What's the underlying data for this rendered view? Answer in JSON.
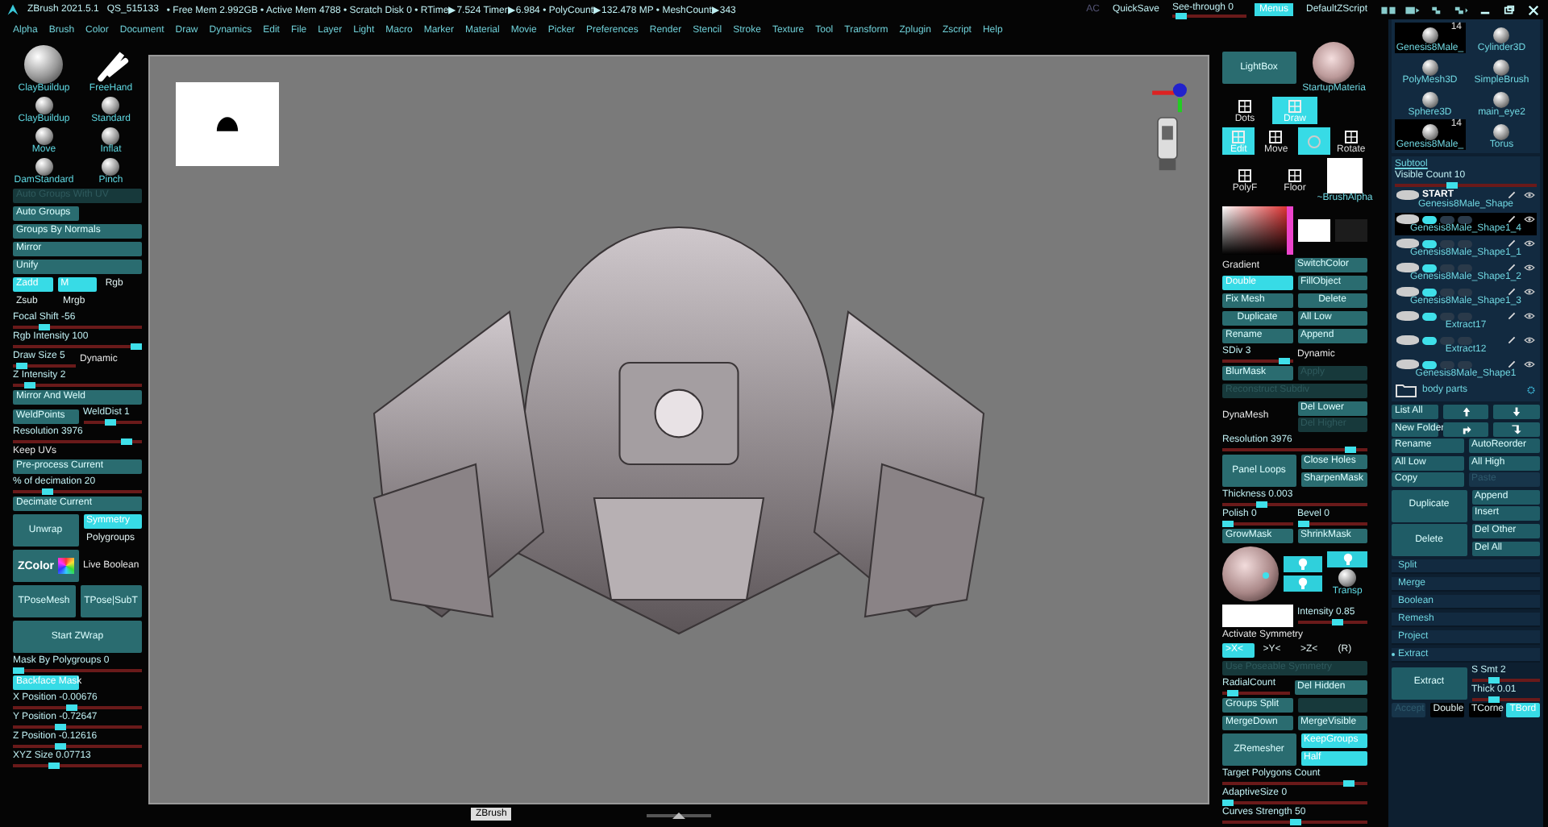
{
  "title_bar": {
    "app": "ZBrush 2021.5.1",
    "project": "QS_515133",
    "stats": "• Free Mem 2.992GB • Active Mem 4788 • Scratch Disk 0 • RTime▶7.524 Timer▶6.984 • PolyCount▶132.478 MP • MeshCount▶343",
    "ac": "AC",
    "quicksave": "QuickSave",
    "see_through": {
      "label": "See-through  0",
      "level": 0.05
    },
    "menus": {
      "label": "Menus",
      "selected": true
    },
    "script": "DefaultZScript"
  },
  "menu_bar": [
    "Alpha",
    "Brush",
    "Color",
    "Document",
    "Draw",
    "Dynamics",
    "Edit",
    "File",
    "Layer",
    "Light",
    "Macro",
    "Marker",
    "Material",
    "Movie",
    "Picker",
    "Preferences",
    "Render",
    "Stencil",
    "Stroke",
    "Texture",
    "Tool",
    "Transform",
    "Zplugin",
    "Zscript",
    "Help"
  ],
  "left_panel": [
    [
      {
        "kind": "brush-large",
        "label": "ClayBuildup"
      },
      {
        "kind": "stroke",
        "label": "FreeHand"
      }
    ],
    [
      {
        "kind": "brush",
        "label": "ClayBuildup"
      },
      {
        "kind": "brush",
        "label": "Standard"
      }
    ],
    [
      {
        "kind": "brush",
        "label": "Move"
      },
      {
        "kind": "brush",
        "label": "Inflat"
      }
    ],
    [
      {
        "kind": "brush",
        "label": "DamStandard"
      },
      {
        "kind": "brush",
        "label": "Pinch"
      }
    ],
    [
      {
        "kind": "disabled",
        "label": "Auto Groups With UV"
      }
    ],
    [
      {
        "kind": "button",
        "label": "Auto Groups"
      },
      {
        "kind": "space"
      }
    ],
    [
      {
        "kind": "button",
        "label": "Groups By Normals"
      }
    ],
    [
      {
        "kind": "button",
        "label": "Mirror"
      }
    ],
    [
      {
        "kind": "button",
        "label": "Unify"
      }
    ],
    [
      {
        "kind": "toggle",
        "label": "Zadd",
        "selected": true
      },
      {
        "kind": "toggle",
        "label": "M",
        "selected": true
      },
      {
        "kind": "toggle",
        "label": "Rgb",
        "selected": false
      }
    ],
    [
      {
        "kind": "toggle",
        "label": "Zsub",
        "selected": false
      },
      {
        "kind": "toggle",
        "label": "Mrgb",
        "selected": false
      },
      {
        "kind": "space"
      }
    ],
    [
      {
        "kind": "slider",
        "label": "Focal Shift -56",
        "level": 0.22
      }
    ],
    [
      {
        "kind": "slider",
        "label": "Rgb Intensity 100",
        "level": 1
      }
    ],
    [
      {
        "kind": "slider",
        "label": "Draw Size 5",
        "level": 0.05
      },
      {
        "kind": "label",
        "text": "Dynamic"
      }
    ],
    [
      {
        "kind": "slider",
        "label": "Z Intensity 2",
        "level": 0.1
      }
    ],
    [
      {
        "kind": "button",
        "label": "Mirror And Weld"
      }
    ],
    [
      {
        "kind": "button",
        "label": "WeldPoints"
      },
      {
        "kind": "slider",
        "label": "WeldDist 1",
        "level": 0.45
      }
    ],
    [
      {
        "kind": "slider",
        "label": "Resolution 3976",
        "level": 0.92
      }
    ],
    [
      {
        "kind": "label",
        "text": "Keep UVs"
      }
    ],
    [
      {
        "kind": "button",
        "label": "Pre-process Current"
      }
    ],
    [
      {
        "kind": "slider",
        "label": "% of decimation 20",
        "level": 0.25
      }
    ],
    [
      {
        "kind": "button",
        "label": "Decimate Current"
      }
    ],
    [
      {
        "kind": "tall",
        "label": "Unwrap"
      },
      {
        "kind": "stack",
        "items": [
          {
            "kind": "toggle",
            "label": "Symmetry",
            "selected": true
          },
          {
            "kind": "toggle",
            "label": "Polygroups",
            "selected": false
          }
        ]
      }
    ],
    [
      {
        "kind": "zcolor",
        "label": "ZColor"
      },
      {
        "kind": "label",
        "text": "Live Boolean"
      }
    ],
    [
      {
        "kind": "tall",
        "label": "TPoseMesh"
      },
      {
        "kind": "tall",
        "label": "TPose|SubT"
      }
    ],
    [
      {
        "kind": "tall",
        "label": "Start ZWrap"
      }
    ],
    [
      {
        "kind": "slider",
        "label": "Mask By Polygroups 0",
        "level": 0
      }
    ],
    [
      {
        "kind": "toggle",
        "label": "Backface Mask",
        "selected": true
      },
      {
        "kind": "space"
      }
    ],
    [
      {
        "kind": "slider",
        "label": "X Position -0.00676",
        "level": 0.45
      }
    ],
    [
      {
        "kind": "slider",
        "label": "Y Position -0.72647",
        "level": 0.35
      }
    ],
    [
      {
        "kind": "slider",
        "label": "Z Position -0.12616",
        "level": 0.35
      }
    ],
    [
      {
        "kind": "slider",
        "label": "XYZ Size 0.07713",
        "level": 0.3
      }
    ]
  ],
  "canvas": {
    "tooltip": "ZBrush"
  },
  "middle_panel": [
    [
      {
        "kind": "tall",
        "label": "LightBox"
      },
      {
        "kind": "material",
        "label": "StartupMateria"
      }
    ],
    [
      {
        "kind": "tool",
        "label": "Dots",
        "selected": false
      },
      {
        "kind": "tool",
        "label": "Draw",
        "selected": true
      },
      {
        "kind": "space"
      }
    ],
    [
      {
        "kind": "tool",
        "label": "Edit",
        "selected": true
      },
      {
        "kind": "tool",
        "label": "Move",
        "selected": false
      },
      {
        "kind": "ring",
        "selected": true
      },
      {
        "kind": "tool",
        "label": "Rotate",
        "selected": false
      }
    ],
    [
      {
        "kind": "tool",
        "label": "PolyF",
        "selected": false
      },
      {
        "kind": "tool",
        "label": "Floor",
        "selected": false
      },
      {
        "kind": "alpha",
        "label": "~BrushAlpha"
      }
    ],
    [
      {
        "kind": "picker"
      },
      {
        "kind": "swatch",
        "color": "#ffffff"
      },
      {
        "kind": "swatch",
        "color": "#1c1c1c"
      }
    ],
    [
      {
        "kind": "label",
        "text": "Gradient"
      },
      {
        "kind": "button",
        "label": "SwitchColor"
      }
    ],
    [
      {
        "kind": "toggle",
        "label": "Double",
        "selected": true
      },
      {
        "kind": "button",
        "label": "FillObject"
      }
    ],
    [
      {
        "kind": "stack",
        "items": [
          {
            "kind": "button",
            "label": "Fix Mesh"
          },
          {
            "kind": "tall",
            "label": "Duplicate"
          }
        ]
      },
      {
        "kind": "stack",
        "items": [
          {
            "kind": "tall",
            "label": "Delete"
          },
          {
            "kind": "button",
            "label": "All Low"
          }
        ]
      }
    ],
    [
      {
        "kind": "button",
        "label": "Rename"
      },
      {
        "kind": "button",
        "label": "Append"
      }
    ],
    [
      {
        "kind": "slider",
        "label": "SDiv 3",
        "level": 0.95
      },
      {
        "kind": "label",
        "text": "Dynamic"
      }
    ],
    [
      {
        "kind": "button",
        "label": "BlurMask"
      },
      {
        "kind": "disabled",
        "label": "Apply"
      }
    ],
    [
      {
        "kind": "disabled",
        "label": "Reconstruct Subdiv"
      }
    ],
    [
      {
        "kind": "label",
        "text": "DynaMesh"
      },
      {
        "kind": "stack",
        "items": [
          {
            "kind": "button",
            "label": "Del Lower"
          },
          {
            "kind": "disabled",
            "label": "Del Higher"
          }
        ]
      }
    ],
    [
      {
        "kind": "slider",
        "label": "Resolution 3976",
        "level": 0.92
      }
    ],
    [
      {
        "kind": "tall",
        "label": "Panel Loops"
      },
      {
        "kind": "stack",
        "items": [
          {
            "kind": "button",
            "label": "Close Holes"
          },
          {
            "kind": "button",
            "label": "SharpenMask"
          }
        ]
      }
    ],
    [
      {
        "kind": "slider",
        "label": "Thickness 0.003",
        "level": 0.25
      }
    ],
    [
      {
        "kind": "slider",
        "label": "Polish 0",
        "level": 0
      },
      {
        "kind": "slider",
        "label": "Bevel 0",
        "level": 0
      }
    ],
    [
      {
        "kind": "button",
        "label": "GrowMask"
      },
      {
        "kind": "button",
        "label": "ShrinkMask"
      }
    ],
    [
      {
        "kind": "light-sphere"
      },
      {
        "kind": "stack",
        "items": [
          {
            "kind": "bulb"
          },
          {
            "kind": "bulb"
          }
        ]
      },
      {
        "kind": "stack",
        "items": [
          {
            "kind": "bulb"
          },
          {
            "kind": "transp",
            "label": "Transp"
          }
        ]
      }
    ],
    [
      {
        "kind": "swatch",
        "color": "#ffffff"
      },
      {
        "kind": "slider",
        "label": "Intensity 0.85",
        "level": 0.6
      }
    ],
    [
      {
        "kind": "label",
        "text": "Activate Symmetry"
      }
    ],
    [
      {
        "kind": "toggle",
        "label": ">X<",
        "selected": true
      },
      {
        "kind": "toggle",
        "label": ">Y<",
        "selected": false
      },
      {
        "kind": "toggle",
        "label": ">Z<",
        "selected": false
      },
      {
        "kind": "toggle",
        "label": "(R)",
        "selected": false
      }
    ],
    [
      {
        "kind": "disabled",
        "label": "Use Poseable Symmetry"
      }
    ],
    [
      {
        "kind": "slider",
        "label": "RadialCount",
        "level": 0.1
      },
      {
        "kind": "button",
        "label": "Del Hidden"
      }
    ],
    [
      {
        "kind": "button",
        "label": "Groups Split"
      },
      {
        "kind": "disabled"
      }
    ],
    [
      {
        "kind": "button",
        "label": "MergeDown"
      },
      {
        "kind": "button",
        "label": "MergeVisible"
      }
    ],
    [
      {
        "kind": "tall",
        "label": "ZRemesher"
      },
      {
        "kind": "stack",
        "items": [
          {
            "kind": "toggle",
            "label": "KeepGroups",
            "selected": true
          },
          {
            "kind": "toggle",
            "label": "Half",
            "selected": true
          }
        ]
      }
    ],
    [
      {
        "kind": "slider",
        "label": "Target Polygons Count",
        "level": 0.9
      }
    ],
    [
      {
        "kind": "slider",
        "label": "AdaptiveSize 0",
        "level": 0
      }
    ],
    [
      {
        "kind": "slider",
        "label": "Curves Strength 50",
        "level": 0.5
      }
    ]
  ],
  "tool_panel": {
    "tools": [
      {
        "label": "Genesis8Male_",
        "badge": "14",
        "selected": true
      },
      {
        "label": "Cylinder3D",
        "selected": false
      },
      {
        "label": "PolyMesh3D",
        "selected": false
      },
      {
        "label": "SimpleBrush",
        "selected": false
      },
      {
        "label": "Sphere3D",
        "selected": false
      },
      {
        "label": "main_eye2",
        "selected": false
      },
      {
        "label": "Genesis8Male_",
        "badge": "14",
        "selected": true
      },
      {
        "label": "Torus",
        "selected": false
      }
    ],
    "subtool_title": "Subtool",
    "visible_count": {
      "label": "Visible Count 10",
      "level": 0.4
    },
    "start_label": "START",
    "subtools": [
      {
        "name": "Genesis8Male_Shape",
        "selected": false
      },
      {
        "name": "Genesis8Male_Shape1_4",
        "selected": true
      },
      {
        "name": "Genesis8Male_Shape1_1",
        "selected": false
      },
      {
        "name": "Genesis8Male_Shape1_2",
        "selected": false
      },
      {
        "name": "Genesis8Male_Shape1_3",
        "selected": false
      },
      {
        "name": "Extract17",
        "selected": false
      },
      {
        "name": "Extract12",
        "selected": false
      },
      {
        "name": "Genesis8Male_Shape1",
        "selected": false
      }
    ],
    "folder": "body parts",
    "rows": [
      [
        {
          "kind": "button",
          "label": "List All"
        },
        {
          "kind": "arrow-up"
        },
        {
          "kind": "arrow-down"
        }
      ],
      [
        {
          "kind": "button",
          "label": "New Folder"
        },
        {
          "kind": "turn-right"
        },
        {
          "kind": "turn-down"
        }
      ],
      [
        {
          "kind": "button",
          "label": "Rename"
        },
        {
          "kind": "button",
          "label": "AutoReorder"
        }
      ],
      [
        {
          "kind": "button",
          "label": "All Low"
        },
        {
          "kind": "button",
          "label": "All High"
        }
      ],
      [
        {
          "kind": "button",
          "label": "Copy"
        },
        {
          "kind": "disabled",
          "label": "Paste"
        }
      ],
      [
        {
          "kind": "tall",
          "label": "Duplicate"
        },
        {
          "kind": "stack",
          "items": [
            {
              "kind": "button",
              "label": "Append"
            },
            {
              "kind": "button",
              "label": "Insert"
            }
          ]
        }
      ],
      [
        {
          "kind": "tall",
          "label": "Delete"
        },
        {
          "kind": "stack",
          "items": [
            {
              "kind": "button",
              "label": "Del Other"
            },
            {
              "kind": "button",
              "label": "Del All"
            }
          ]
        }
      ]
    ],
    "sections": [
      {
        "label": "Split",
        "expanded": false
      },
      {
        "label": "Merge",
        "expanded": false
      },
      {
        "label": "Boolean",
        "expanded": false
      },
      {
        "label": "Remesh",
        "expanded": false
      },
      {
        "label": "Project",
        "expanded": false
      },
      {
        "label": "Extract",
        "expanded": true
      }
    ],
    "extract_rows": [
      [
        {
          "kind": "tall",
          "label": "Extract"
        },
        {
          "kind": "stack",
          "items": [
            {
              "kind": "slider",
              "label": "S Smt 2",
              "level": 0.3
            },
            {
              "kind": "slider",
              "label": "Thick 0.01",
              "level": 0.3
            }
          ]
        }
      ],
      [
        {
          "kind": "disabled",
          "label": "Accept"
        },
        {
          "kind": "toggle",
          "label": "Double",
          "selected": false
        },
        {
          "kind": "toggle",
          "label": "TCorne",
          "selected": false
        },
        {
          "kind": "toggle",
          "label": "TBord",
          "selected": true
        }
      ]
    ]
  }
}
